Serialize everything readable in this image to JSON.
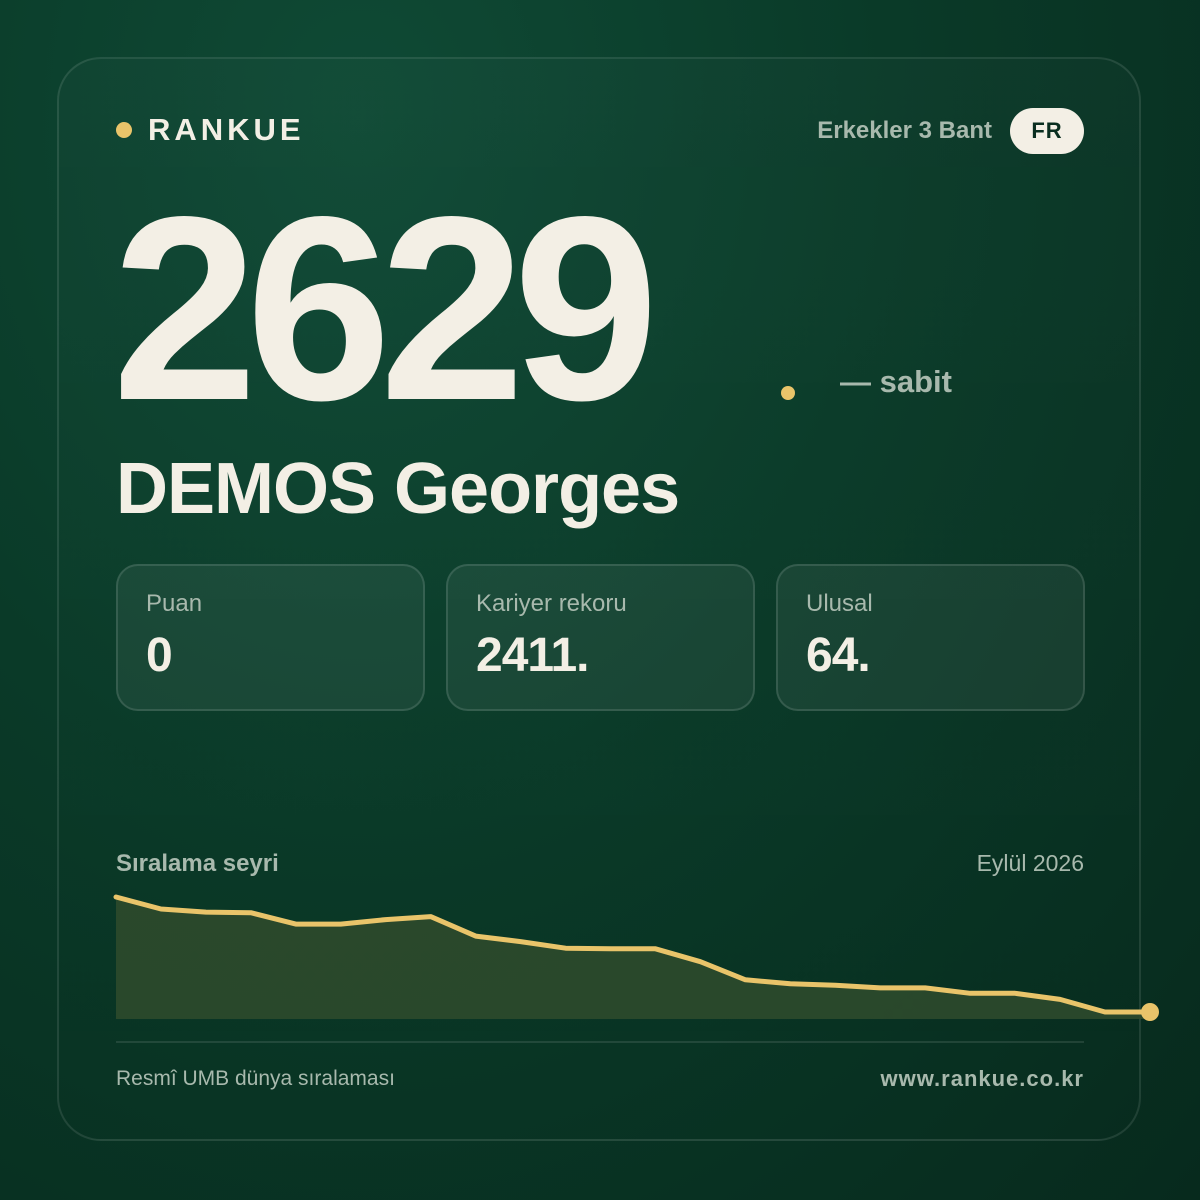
{
  "brand": {
    "name": "RANKUE"
  },
  "header": {
    "category": "Erkekler 3 Bant",
    "country": "FR"
  },
  "hero": {
    "rank": "2629",
    "trend": "— sabit"
  },
  "player": {
    "name": "DEMOS Georges"
  },
  "stats": [
    {
      "label": "Puan",
      "value": "0"
    },
    {
      "label": "Kariyer rekoru",
      "value": "2411."
    },
    {
      "label": "Ulusal",
      "value": "64."
    }
  ],
  "chart": {
    "title": "Sıralama seyri",
    "date": "Eylül 2026"
  },
  "chart_data": {
    "type": "area",
    "inverted_y": true,
    "values": [
      2330,
      2370,
      2380,
      2382,
      2420,
      2420,
      2405,
      2395,
      2460,
      2478,
      2500,
      2502,
      2502,
      2545,
      2605,
      2618,
      2623,
      2632,
      2632,
      2650,
      2650,
      2670,
      2712,
      2712
    ],
    "ylim": [
      2712,
      2200
    ],
    "line_color": "#e9c46a",
    "fill_color": "#2e4a2c"
  },
  "footer": {
    "source": "Resmî UMB dünya sıralaması",
    "url": "www.rankue.co.kr"
  },
  "colors": {
    "accent": "#e9c46a",
    "text": "#f3efe5",
    "muted": "#a8b9ad",
    "background": "#0a3a28"
  }
}
